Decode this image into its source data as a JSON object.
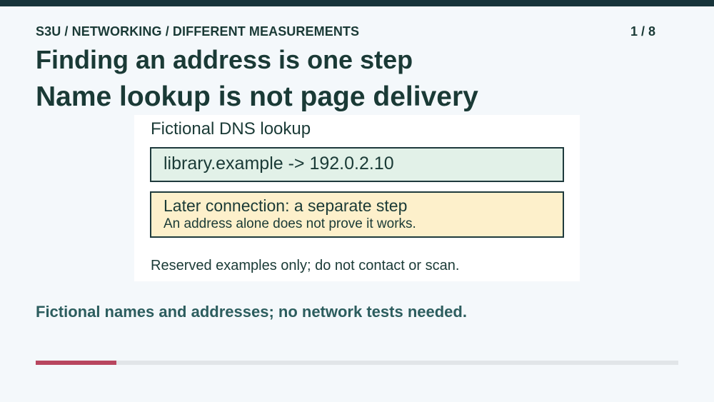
{
  "header": {
    "breadcrumb": "S3U / NETWORKING / DIFFERENT MEASUREMENTS",
    "page_counter": "1 / 8"
  },
  "slide": {
    "title": "Finding an address is one step",
    "subtitle": "Name lookup is not page delivery"
  },
  "panel": {
    "title": "Fictional DNS lookup",
    "lookup": "library.example -> 192.0.2.10",
    "connection_title": "Later connection: a separate step",
    "connection_note": "An address alone does not prove it works.",
    "footnote": "Reserved examples only; do not contact or scan."
  },
  "caption": "Fictional names and addresses; no network tests needed.",
  "progress": {
    "fraction": 0.125
  },
  "colors": {
    "top_bar": "#17343a",
    "text": "#1a3a36",
    "caption": "#2c5d5e",
    "lookup_bg": "#e2f1e8",
    "connection_bg": "#fdf0cb",
    "progress_fill": "#b8465f",
    "progress_track": "#e1e5e8"
  }
}
